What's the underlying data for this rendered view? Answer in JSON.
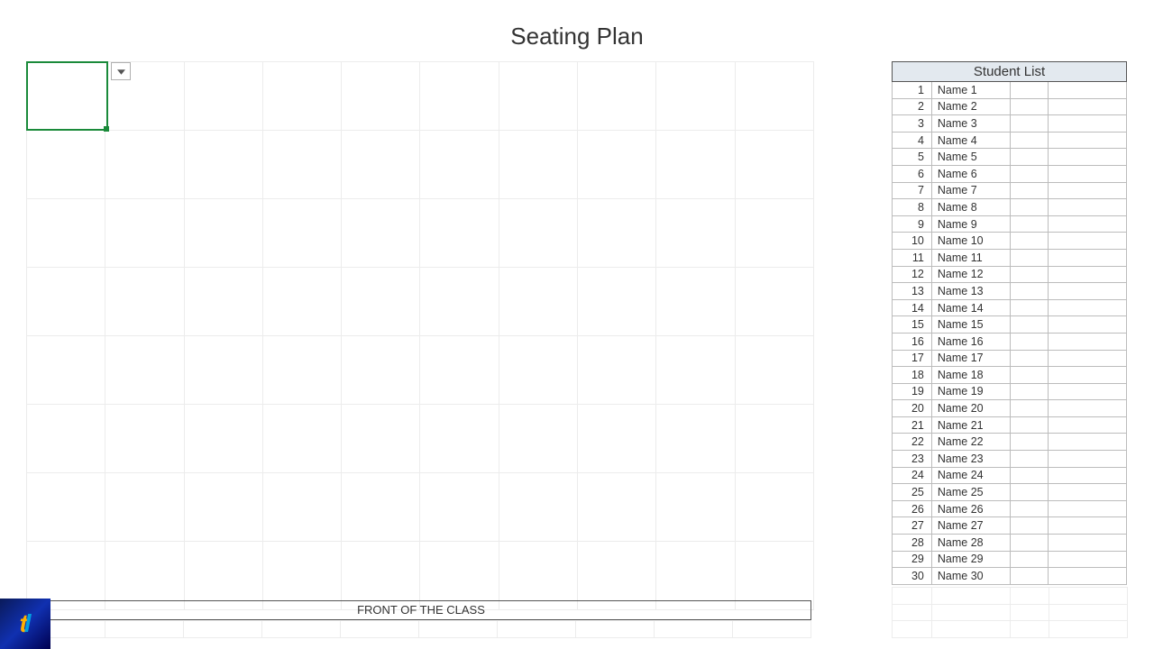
{
  "title": "Seating Plan",
  "front_label": "FRONT OF THE CLASS",
  "student_list": {
    "header": "Student List",
    "rows": [
      {
        "num": "1",
        "name": "Name 1"
      },
      {
        "num": "2",
        "name": "Name 2"
      },
      {
        "num": "3",
        "name": "Name 3"
      },
      {
        "num": "4",
        "name": "Name 4"
      },
      {
        "num": "5",
        "name": "Name 5"
      },
      {
        "num": "6",
        "name": "Name 6"
      },
      {
        "num": "7",
        "name": "Name 7"
      },
      {
        "num": "8",
        "name": "Name 8"
      },
      {
        "num": "9",
        "name": "Name 9"
      },
      {
        "num": "10",
        "name": "Name 10"
      },
      {
        "num": "11",
        "name": "Name 11"
      },
      {
        "num": "12",
        "name": "Name 12"
      },
      {
        "num": "13",
        "name": "Name 13"
      },
      {
        "num": "14",
        "name": "Name 14"
      },
      {
        "num": "15",
        "name": "Name 15"
      },
      {
        "num": "16",
        "name": "Name 16"
      },
      {
        "num": "17",
        "name": "Name 17"
      },
      {
        "num": "18",
        "name": "Name 18"
      },
      {
        "num": "19",
        "name": "Name 19"
      },
      {
        "num": "20",
        "name": "Name 20"
      },
      {
        "num": "21",
        "name": "Name 21"
      },
      {
        "num": "22",
        "name": "Name 22"
      },
      {
        "num": "23",
        "name": "Name 23"
      },
      {
        "num": "24",
        "name": "Name 24"
      },
      {
        "num": "25",
        "name": "Name 25"
      },
      {
        "num": "26",
        "name": "Name 26"
      },
      {
        "num": "27",
        "name": "Name 27"
      },
      {
        "num": "28",
        "name": "Name 28"
      },
      {
        "num": "29",
        "name": "Name 29"
      },
      {
        "num": "30",
        "name": "Name 30"
      }
    ]
  },
  "grid": {
    "cols": 10,
    "large_rows": 8
  }
}
